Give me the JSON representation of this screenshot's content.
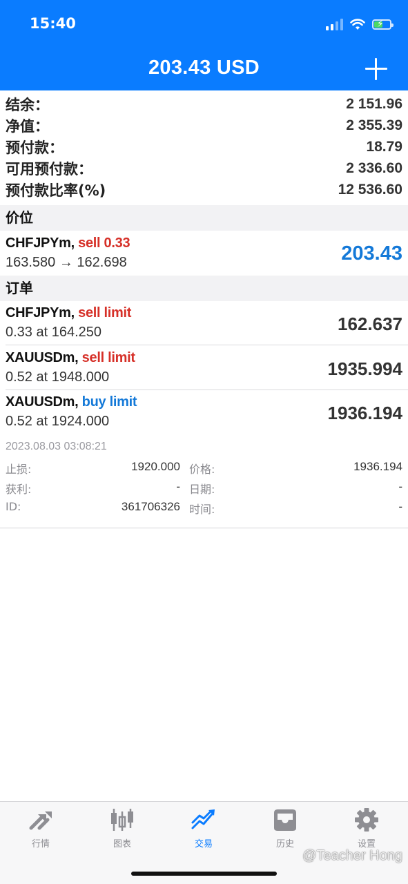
{
  "status_bar": {
    "time": "15:40"
  },
  "header": {
    "title": "203.43 USD"
  },
  "summary": [
    {
      "label": "结余：",
      "value": "2 151.96"
    },
    {
      "label": "净值：",
      "value": "2 355.39"
    },
    {
      "label": "预付款：",
      "value": "18.79"
    },
    {
      "label": "可用预付款：",
      "value": "2 336.60"
    },
    {
      "label": "预付款比率(%)",
      "value": "12 536.60"
    }
  ],
  "positions_section": {
    "title": "价位"
  },
  "positions": [
    {
      "symbol": "CHFJPYm,",
      "action": "sell 0.33",
      "detail": "163.580 → 162.698",
      "value": "203.43"
    }
  ],
  "orders_section": {
    "title": "订单"
  },
  "orders": [
    {
      "symbol": "CHFJPYm,",
      "action": "sell limit",
      "detail": "0.33 at 164.250",
      "price": "162.637"
    },
    {
      "symbol": "XAUUSDm,",
      "action": "sell limit",
      "detail": "0.52 at 1948.000",
      "price": "1935.994"
    },
    {
      "symbol": "XAUUSDm,",
      "action": "buy limit",
      "detail": "0.52 at 1924.000",
      "price": "1936.194"
    }
  ],
  "order_detail": {
    "date": "2023.08.03 03:08:21",
    "rows": [
      {
        "l1": "止损:",
        "v1": "1920.000",
        "l2": "价格:",
        "v2": "1936.194"
      },
      {
        "l1": "获利:",
        "v1": "-",
        "l2": "日期:",
        "v2": "-"
      },
      {
        "l1": "ID:",
        "v1": "361706326",
        "l2": "时间:",
        "v2": "-"
      }
    ]
  },
  "tabs": [
    {
      "label": "行情",
      "icon": "quotes-arrows-icon",
      "active": false
    },
    {
      "label": "图表",
      "icon": "candlestick-chart-icon",
      "active": false
    },
    {
      "label": "交易",
      "icon": "trade-trend-icon",
      "active": true
    },
    {
      "label": "历史",
      "icon": "history-inbox-icon",
      "active": false
    },
    {
      "label": "设置",
      "icon": "gear-icon",
      "active": false
    }
  ],
  "watermark": "@Teacher Hong",
  "colors": {
    "accent": "#0a7cff",
    "sell": "#d63028",
    "buy": "#1479d8"
  }
}
